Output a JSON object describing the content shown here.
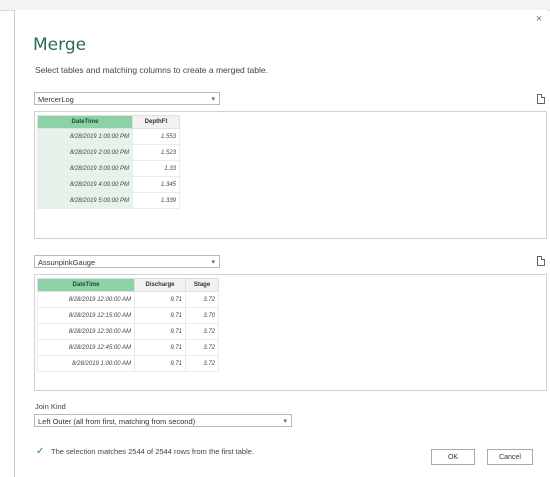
{
  "dialog": {
    "title": "Merge",
    "subtitle": "Select tables and matching columns to create a merged table.",
    "close_glyph": "×"
  },
  "table1": {
    "selected": "MercerLog",
    "columns": [
      "DateTime",
      "DepthFt"
    ],
    "rows": [
      [
        "8/28/2019 1:00:00 PM",
        "1.553"
      ],
      [
        "8/28/2019 2:00:00 PM",
        "1.523"
      ],
      [
        "8/28/2019 3:00:00 PM",
        "1.33"
      ],
      [
        "8/28/2019 4:00:00 PM",
        "1.345"
      ],
      [
        "8/28/2019 5:00:00 PM",
        "1.339"
      ]
    ]
  },
  "table2": {
    "selected": "AssunpinkGauge",
    "columns": [
      "DateTime",
      "Discharge",
      "Stage"
    ],
    "rows": [
      [
        "8/28/2019 12:00:00 AM",
        "9.71",
        "3.72"
      ],
      [
        "8/28/2019 12:15:00 AM",
        "9.71",
        "3.70"
      ],
      [
        "8/28/2019 12:30:00 AM",
        "9.71",
        "3.72"
      ],
      [
        "8/28/2019 12:45:00 AM",
        "9.71",
        "3.72"
      ],
      [
        "8/28/2019 1:00:00 AM",
        "9.71",
        "3.72"
      ]
    ]
  },
  "join": {
    "label": "Join Kind",
    "selected": "Left Outer (all from first, matching from second)"
  },
  "status": {
    "check_glyph": "✓",
    "message": "The selection matches 2544 of 2544 rows from the first table."
  },
  "buttons": {
    "ok": "OK",
    "cancel": "Cancel"
  },
  "icons": {
    "chevron": "▾"
  },
  "colors": {
    "title": "#2b6b54",
    "selected_header": "#8fd1a7",
    "selected_column": "#e6f3ea",
    "check": "#2c8a4a"
  }
}
